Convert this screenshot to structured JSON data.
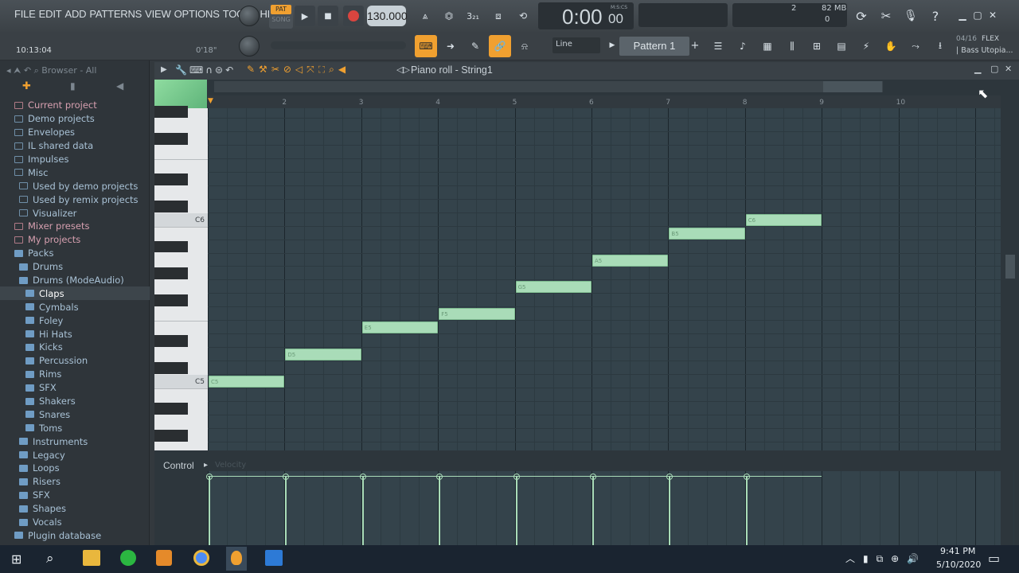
{
  "menu": [
    "FILE",
    "EDIT",
    "ADD",
    "PATTERNS",
    "VIEW",
    "OPTIONS",
    "TOOLS",
    "HELP"
  ],
  "transport": {
    "pat_label": "PAT",
    "song_label": "SONG",
    "tempo": "130.000",
    "time_main": "0:00",
    "time_sub": "00",
    "time_unit": "M:S:CS"
  },
  "status": {
    "clock": "10:13:04",
    "duration": "0'18\"",
    "cpu": "2",
    "memory": "82 MB",
    "voices": "0"
  },
  "toolbar2": {
    "snap": "Line",
    "pattern": "Pattern 1",
    "plus": "+"
  },
  "flex": {
    "count": "04/16",
    "name": "FLEX",
    "preset": "| Bass Utopia..."
  },
  "browser": {
    "title": "Browser - All",
    "items": [
      {
        "label": "Current project",
        "style": "pink"
      },
      {
        "label": "Demo projects",
        "style": "folder"
      },
      {
        "label": "Envelopes",
        "style": "folder"
      },
      {
        "label": "IL shared data",
        "style": "folder"
      },
      {
        "label": "Impulses",
        "style": "folder"
      },
      {
        "label": "Misc",
        "style": "folder"
      },
      {
        "label": "Used by demo projects",
        "style": "folder-sub"
      },
      {
        "label": "Used by remix projects",
        "style": "folder-sub"
      },
      {
        "label": "Visualizer",
        "style": "folder-sub"
      },
      {
        "label": "Mixer presets",
        "style": "pink"
      },
      {
        "label": "My projects",
        "style": "pink"
      },
      {
        "label": "Packs",
        "style": "pack"
      },
      {
        "label": "Drums",
        "style": "pack-sub"
      },
      {
        "label": "Drums (ModeAudio)",
        "style": "pack-sub"
      },
      {
        "label": "Claps",
        "style": "pack-sub2-sel"
      },
      {
        "label": "Cymbals",
        "style": "pack-sub2"
      },
      {
        "label": "Foley",
        "style": "pack-sub2"
      },
      {
        "label": "Hi Hats",
        "style": "pack-sub2"
      },
      {
        "label": "Kicks",
        "style": "pack-sub2"
      },
      {
        "label": "Percussion",
        "style": "pack-sub2"
      },
      {
        "label": "Rims",
        "style": "pack-sub2"
      },
      {
        "label": "SFX",
        "style": "pack-sub2"
      },
      {
        "label": "Shakers",
        "style": "pack-sub2"
      },
      {
        "label": "Snares",
        "style": "pack-sub2"
      },
      {
        "label": "Toms",
        "style": "pack-sub2"
      },
      {
        "label": "Instruments",
        "style": "pack-sub"
      },
      {
        "label": "Legacy",
        "style": "pack-sub"
      },
      {
        "label": "Loops",
        "style": "pack-sub"
      },
      {
        "label": "Risers",
        "style": "pack-sub"
      },
      {
        "label": "SFX",
        "style": "pack-sub"
      },
      {
        "label": "Shapes",
        "style": "pack-sub"
      },
      {
        "label": "Vocals",
        "style": "pack-sub"
      },
      {
        "label": "Plugin database",
        "style": "pack"
      }
    ]
  },
  "pianoroll": {
    "title": "Piano roll - String1",
    "bars": [
      "2",
      "3",
      "4",
      "5",
      "6",
      "7",
      "8",
      "9",
      "10"
    ],
    "key_labels": [
      "C6",
      "C5"
    ]
  },
  "notes": [
    {
      "label": "C5",
      "bar": 1,
      "pitch": 0
    },
    {
      "label": "D5",
      "bar": 2,
      "pitch": 2
    },
    {
      "label": "E5",
      "bar": 3,
      "pitch": 4
    },
    {
      "label": "F5",
      "bar": 4,
      "pitch": 5
    },
    {
      "label": "G5",
      "bar": 5,
      "pitch": 7
    },
    {
      "label": "A5",
      "bar": 6,
      "pitch": 9
    },
    {
      "label": "B5",
      "bar": 7,
      "pitch": 11
    },
    {
      "label": "C6",
      "bar": 8,
      "pitch": 12
    }
  ],
  "control": {
    "label": "Control",
    "param": "Velocity"
  },
  "taskbar": {
    "time": "9:41 PM",
    "date": "5/10/2020"
  },
  "colors": {
    "note_fill": "#a9dcb8",
    "grid": "#34434b",
    "accent": "#f0a030"
  }
}
